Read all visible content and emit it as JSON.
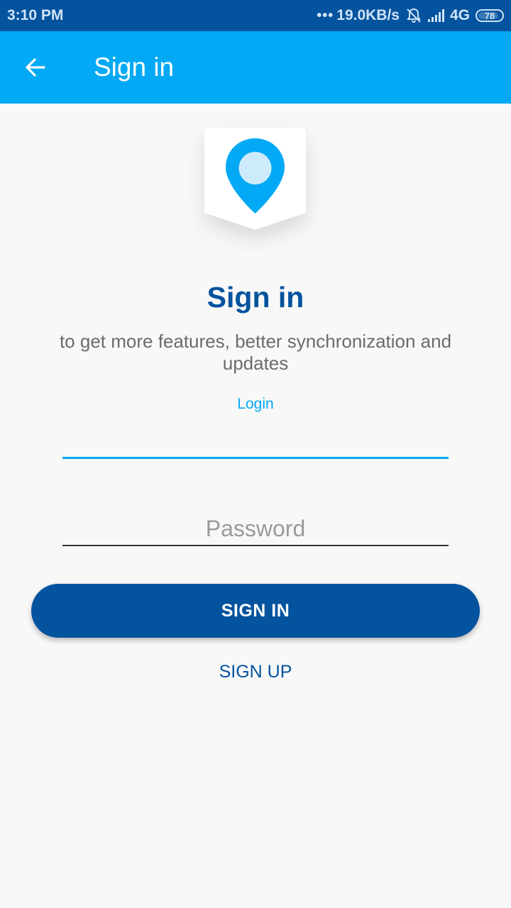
{
  "status_bar": {
    "time": "3:10 PM",
    "network_speed": "19.0KB/s",
    "network_type": "4G",
    "battery": "78",
    "icons": [
      "more-dots-icon",
      "bell-off-icon",
      "signal-icon",
      "battery-icon"
    ]
  },
  "app_bar": {
    "title": "Sign in",
    "back_icon": "arrow-left-icon"
  },
  "logo": {
    "icon": "map-pin-icon",
    "accent": "#03a9f4"
  },
  "content": {
    "heading": "Sign in",
    "subtitle": "to get more features, better synchronization and updates",
    "login_label": "Login",
    "login_value": "",
    "password_placeholder": "Password",
    "password_value": ""
  },
  "actions": {
    "sign_in": "SIGN IN",
    "sign_up": "SIGN UP"
  },
  "colors": {
    "primary": "#03a9f4",
    "primary_dark": "#04539e",
    "background": "#f8f8f8"
  }
}
